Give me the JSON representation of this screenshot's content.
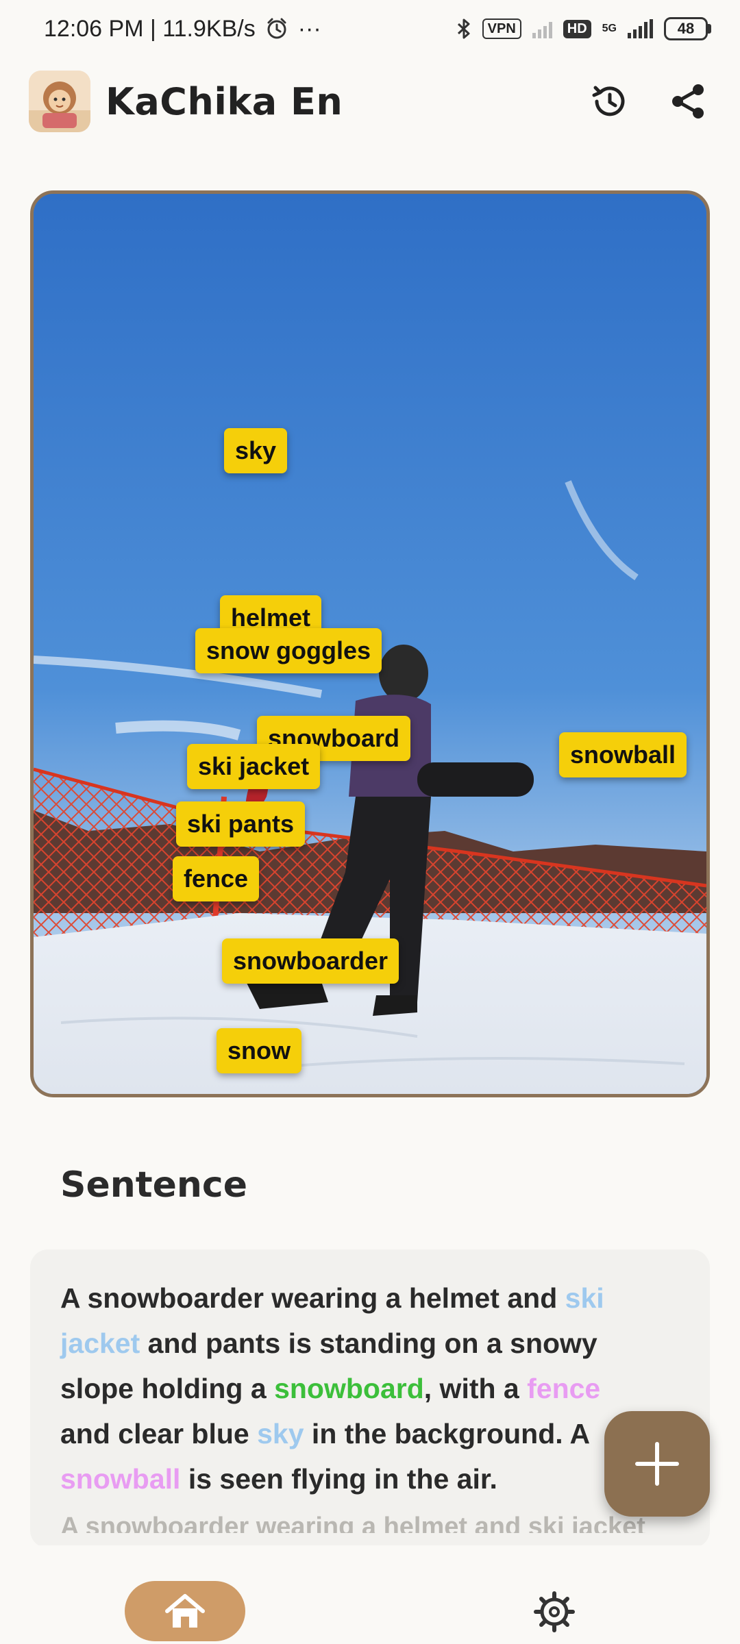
{
  "status_bar": {
    "time_speed": "12:06 PM | 11.9KB/s",
    "more": "···",
    "vpn": "VPN",
    "hd": "HD",
    "network": "5G",
    "battery": "48"
  },
  "header": {
    "title": "KaChika En",
    "history_icon": "history-icon",
    "share_icon": "share-icon"
  },
  "photo": {
    "labels": [
      "sky",
      "helmet",
      "snow goggles",
      "snowboard",
      "snowball",
      "ski jacket",
      "ski pants",
      "fence",
      "snowboarder",
      "snow"
    ]
  },
  "sentence_section": {
    "title": "Sentence",
    "parts": [
      {
        "text": "A snowboarder wearing a helmet and ",
        "style": "plain"
      },
      {
        "text": "ski jacket",
        "style": "blue"
      },
      {
        "text": " and pants is standing on a snowy slope holding a ",
        "style": "plain"
      },
      {
        "text": "snowboard",
        "style": "green"
      },
      {
        "text": ", with a ",
        "style": "plain"
      },
      {
        "text": "fence",
        "style": "pink"
      },
      {
        "text": " and clear blue ",
        "style": "plain"
      },
      {
        "text": "sky",
        "style": "blue"
      },
      {
        "text": " in the background.  A ",
        "style": "plain"
      },
      {
        "text": "snowball",
        "style": "pink"
      },
      {
        "text": " is seen flying in the air.",
        "style": "plain"
      }
    ],
    "cut_off_text": "A snowboarder wearing a helmet and ski jacket and"
  },
  "fab": {
    "icon": "plus-icon"
  },
  "bottom_nav": {
    "home_icon": "home-icon",
    "settings_icon": "settings-gear-icon"
  },
  "colors": {
    "accent_brown": "#8c7051",
    "label_yellow": "#f5cf0a",
    "highlight_blue": "#9ec9ee",
    "highlight_green": "#3cbf3a",
    "highlight_pink": "#e89cf2",
    "nav_home_bg": "#cf9c68"
  }
}
